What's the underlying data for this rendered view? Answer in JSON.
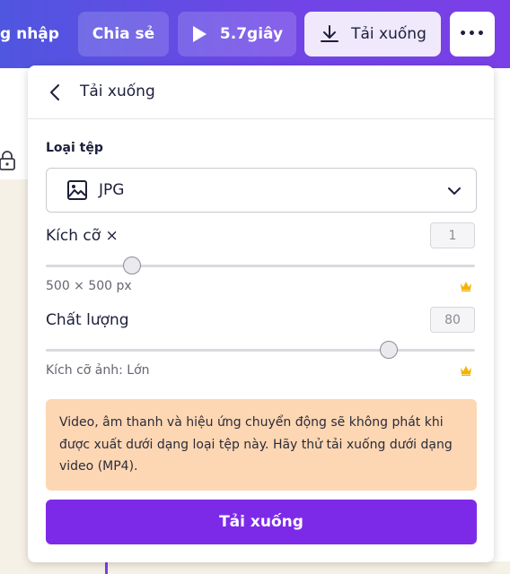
{
  "topbar": {
    "login_label": "g nhập",
    "share_label": "Chia sẻ",
    "play_label": "5.7giây",
    "download_label": "Tải xuống",
    "more_label": "•••"
  },
  "panel": {
    "title": "Tải xuống",
    "file_type": {
      "label": "Loại tệp",
      "selected": "JPG"
    },
    "size": {
      "label": "Kích cỡ ×",
      "value": "1",
      "slider_fraction": 0.2,
      "dimensions": "500 × 500 px"
    },
    "quality": {
      "label": "Chất lượng",
      "value": "80",
      "slider_fraction": 0.8,
      "caption": "Kích cỡ ảnh: Lớn"
    },
    "notice_text": "Video, âm thanh và hiệu ứng chuyển động sẽ không phát khi được xuất dưới dạng loại tệp này. Hãy thử tải xuống dưới dạng video (MP4).",
    "download_button": "Tải xuống"
  },
  "colors": {
    "accent": "#7d2ae8",
    "notice_bg": "#fdd7b3",
    "crown": "#f4b400"
  },
  "icons": [
    "play-icon",
    "download-icon",
    "more-icon",
    "back-icon",
    "image-icon",
    "chevron-down-icon",
    "crown-icon",
    "lock-icon"
  ]
}
